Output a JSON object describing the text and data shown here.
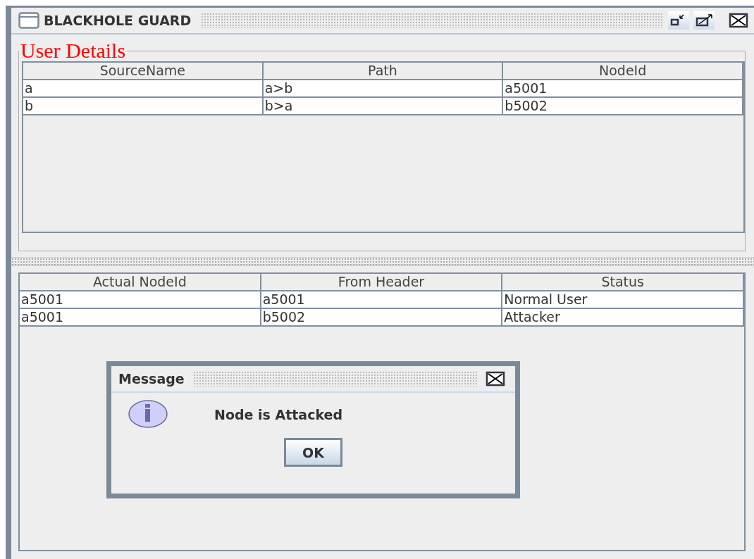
{
  "window": {
    "title": "BLACKHOLE GUARD"
  },
  "user_details": {
    "title": "User Details",
    "columns": [
      "SourceName",
      "Path",
      "NodeId"
    ],
    "rows": [
      [
        "a",
        "a>b",
        "a5001"
      ],
      [
        "b",
        "b>a",
        "b5002"
      ]
    ]
  },
  "status_table": {
    "columns": [
      "Actual NodeId",
      "From Header",
      "Status"
    ],
    "rows": [
      [
        "a5001",
        "a5001",
        "Normal User"
      ],
      [
        "a5001",
        "b5002",
        "Attacker"
      ]
    ]
  },
  "dialog": {
    "title": "Message",
    "message": "Node is Attacked",
    "button": "OK"
  }
}
